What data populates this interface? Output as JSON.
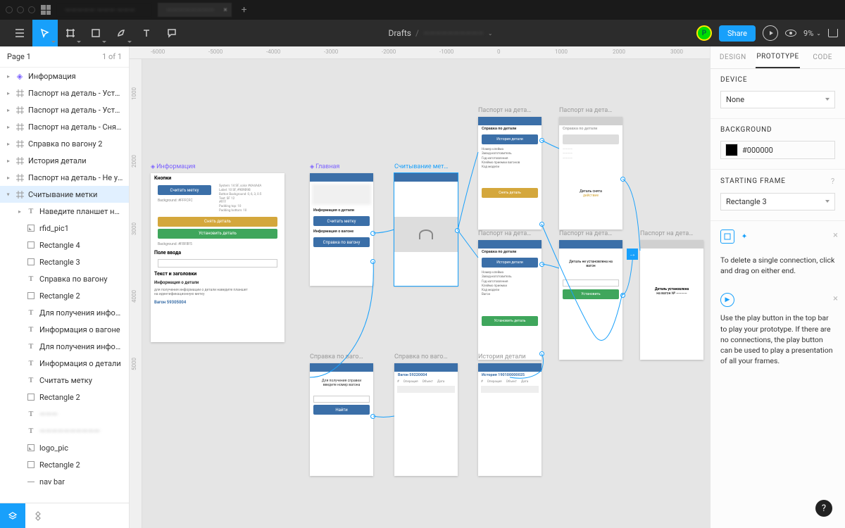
{
  "titlebar": {
    "tab1": "————— ——— ———",
    "tab2": "————————",
    "plus": "+"
  },
  "toolbar": {
    "breadcrumb_root": "Drafts",
    "breadcrumb_file": "——————————",
    "avatar": "P",
    "share": "Share",
    "zoom": "9%"
  },
  "pages": {
    "current": "Page 1",
    "count": "1 of 1"
  },
  "layers": [
    {
      "icon": "comp",
      "label": "Информация",
      "indent": 0,
      "chev": "closed"
    },
    {
      "icon": "frame",
      "label": "Паспорт на деталь - Устано…",
      "indent": 0,
      "chev": "closed"
    },
    {
      "icon": "frame",
      "label": "Паспорт на деталь - Устано…",
      "indent": 0,
      "chev": "closed"
    },
    {
      "icon": "frame",
      "label": "Паспорт на деталь - Снятие",
      "indent": 0,
      "chev": "closed"
    },
    {
      "icon": "frame",
      "label": "Справка по вагону 2",
      "indent": 0,
      "chev": "closed"
    },
    {
      "icon": "frame",
      "label": "История детали",
      "indent": 0,
      "chev": "closed"
    },
    {
      "icon": "frame",
      "label": "Паспорт на деталь - Не уст…",
      "indent": 0,
      "chev": "closed"
    },
    {
      "icon": "frame",
      "label": "Считывание метки",
      "indent": 0,
      "chev": "open",
      "sel": true
    },
    {
      "icon": "text",
      "label": "Наведите планшет на м…",
      "indent": 1,
      "chev": "closed"
    },
    {
      "icon": "img",
      "label": "rfid_pic1",
      "indent": 1
    },
    {
      "icon": "rect",
      "label": "Rectangle 4",
      "indent": 1
    },
    {
      "icon": "rect",
      "label": "Rectangle 3",
      "indent": 1
    },
    {
      "icon": "text",
      "label": "Справка по вагону",
      "indent": 1
    },
    {
      "icon": "rect",
      "label": "Rectangle 2",
      "indent": 1
    },
    {
      "icon": "text",
      "label": "Для получения информ…",
      "indent": 1
    },
    {
      "icon": "text",
      "label": "Информация о вагоне",
      "indent": 1
    },
    {
      "icon": "text",
      "label": "Для получения информ…",
      "indent": 1
    },
    {
      "icon": "text",
      "label": "Информация о детали",
      "indent": 1
    },
    {
      "icon": "text",
      "label": "Считать метку",
      "indent": 1
    },
    {
      "icon": "rect",
      "label": "Rectangle 2",
      "indent": 1
    },
    {
      "icon": "text",
      "label": "———",
      "indent": 1,
      "blur": true
    },
    {
      "icon": "text",
      "label": "——————————",
      "indent": 1,
      "blur": true
    },
    {
      "icon": "img",
      "label": "logo_pic",
      "indent": 1
    },
    {
      "icon": "rect",
      "label": "Rectangle 2",
      "indent": 1
    },
    {
      "icon": "line",
      "label": "nav bar",
      "indent": 1
    }
  ],
  "rulerH": [
    "-6000",
    "-5000",
    "-4000",
    "-3000",
    "-2000",
    "-1000",
    "0",
    "1000",
    "2000",
    "3000"
  ],
  "rulerV": [
    "1000",
    "2000",
    "3000",
    "4000",
    "5000"
  ],
  "right": {
    "tabs": [
      "Design",
      "Prototype",
      "Code"
    ],
    "device_label": "Device",
    "device_value": "None",
    "bg_label": "Background",
    "bg_value": "#000000",
    "start_label": "Starting Frame",
    "start_value": "Rectangle 3",
    "hint1": "To delete a single connection, click and drag on either end.",
    "hint2": "Use the play button in the top bar to play your prototype. If there are no connections, the play button can be used to play a presentation of all your frames."
  },
  "frames": {
    "info": {
      "title": "Информация",
      "h1": "Кнопки",
      "b1": "Считать метку",
      "b2": "Снять деталь",
      "b3": "Установить деталь",
      "h2": "Поле ввода",
      "h3": "Текст и заголовки",
      "t1": "Информация о детали",
      "t2": "Вагон 59305004"
    },
    "main": {
      "title": "Главная",
      "t1": "Информация о детали",
      "b1": "Считать метку",
      "t2": "Информация о вагоне",
      "b2": "Справка по вагону"
    },
    "scan": {
      "title": "Считывание мет…"
    },
    "pass1": {
      "title": "Паспорт на дета…",
      "sub": "Справка по детали",
      "b1": "История детали",
      "b2": "Снять деталь"
    },
    "pass2": {
      "title": "Паспорт на дета…",
      "sub": "Справка по детали",
      "t1": "Деталь снята"
    },
    "pass3": {
      "title": "Паспорт на дета…",
      "sub": "Справка по детали",
      "b1": "История детали",
      "b2": "Установить деталь"
    },
    "pass4": {
      "title": "Паспорт на дета…",
      "t1": "Деталь не установлена на вагон",
      "b1": "Установить"
    },
    "pass5": {
      "title": "Паспорт на дета…",
      "t1": "Деталь установлена",
      "t2": "на вагон № ————"
    },
    "spr1": {
      "title": "Справка по ваго…",
      "t1": "Для получения справки введите номер вагона",
      "b1": "Найти"
    },
    "spr2": {
      "title": "Справка по ваго…",
      "t1": "Вагон 59220004",
      "c1": "Операция",
      "c2": "Объект",
      "c3": "Дата"
    },
    "hist": {
      "title": "История детали",
      "t1": "История 190100000025",
      "c1": "Операция",
      "c2": "Объект",
      "c3": "Дата"
    }
  }
}
